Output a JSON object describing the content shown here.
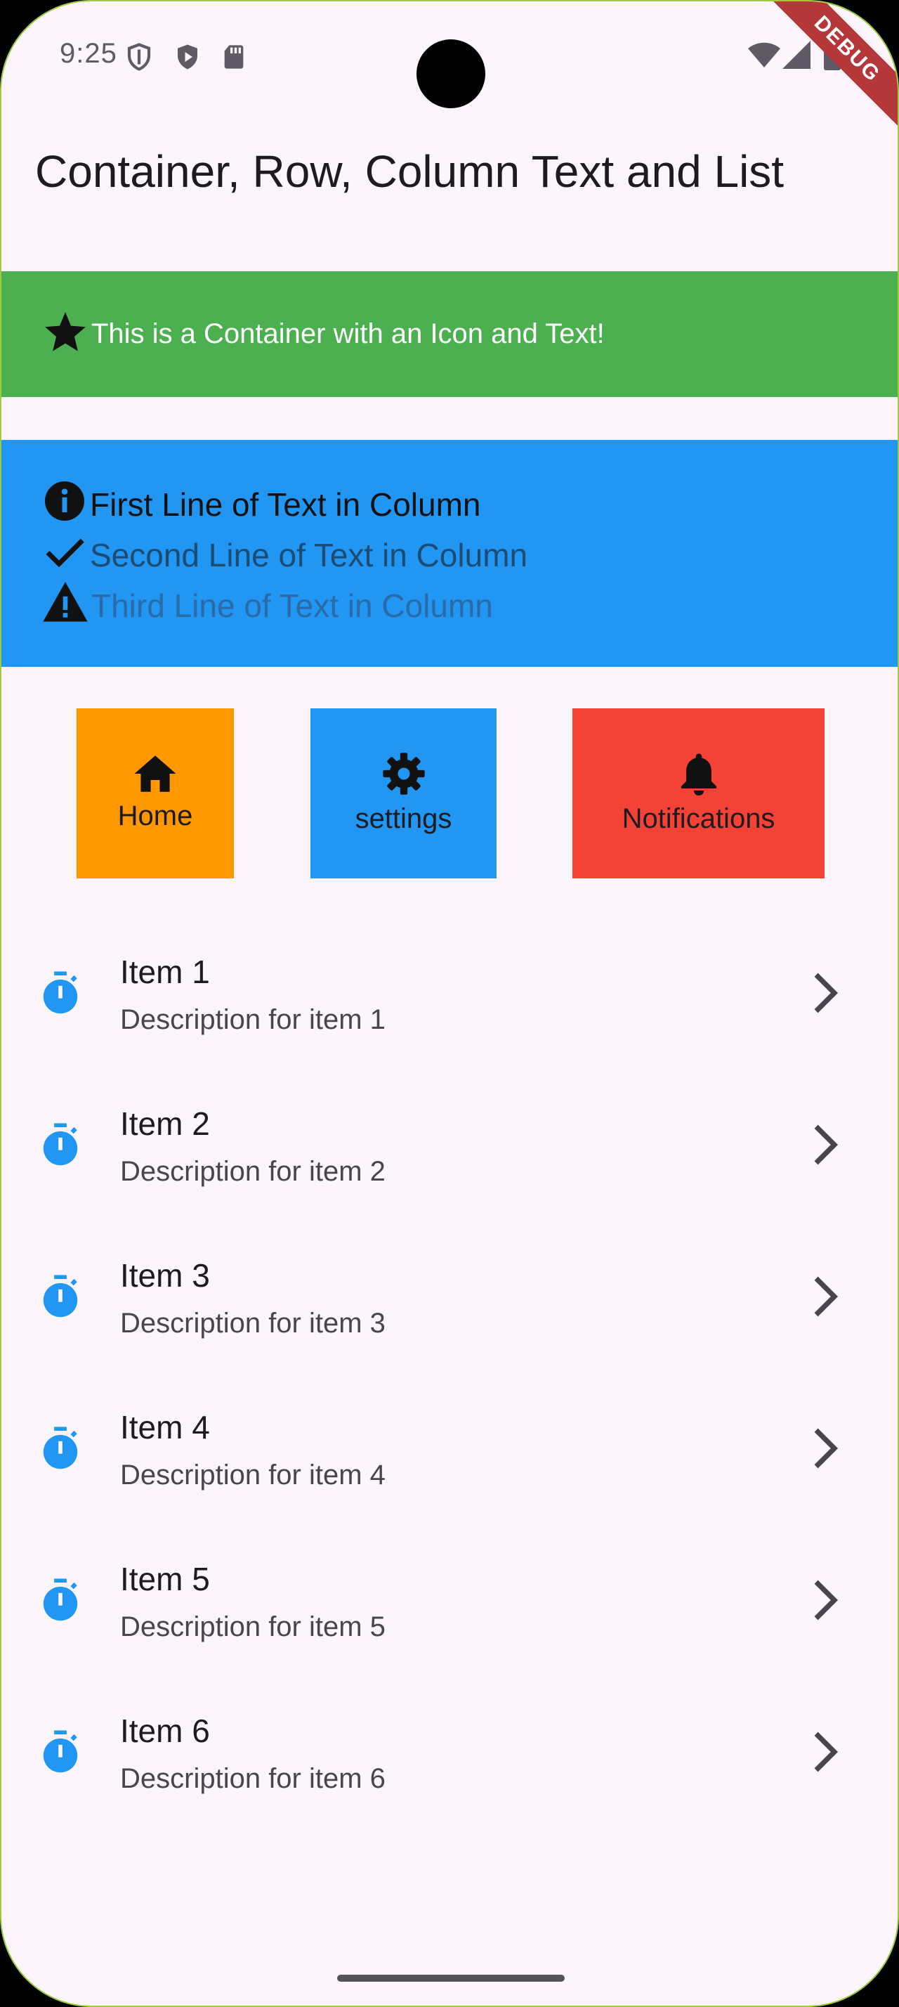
{
  "status_bar": {
    "time": "9:25",
    "left_icons": [
      "shield-outline-icon",
      "shield-play-icon",
      "sd-card-icon"
    ],
    "right_icons": [
      "wifi-icon",
      "signal-icon",
      "battery-icon"
    ],
    "debug_banner": "DEBUG"
  },
  "app_bar": {
    "title": "Container, Row, Column Text and List"
  },
  "green_container": {
    "icon": "star-icon",
    "text": "This is a Container with an Icon and Text!",
    "background": "#4caf50"
  },
  "blue_column": {
    "background": "#2196f3",
    "lines": [
      {
        "icon": "info-icon",
        "text": "First Line of Text in Column",
        "color": "#111111"
      },
      {
        "icon": "check-icon",
        "text": "Second Line of Text in Column",
        "color": "#1c4b73"
      },
      {
        "icon": "warning-icon",
        "text": "Third Line of Text in Column",
        "color": "#2a6aa6"
      }
    ]
  },
  "row_tiles": [
    {
      "icon": "home-icon",
      "label": "Home",
      "background": "#ff9800"
    },
    {
      "icon": "gear-icon",
      "label": "settings",
      "background": "#2196f3"
    },
    {
      "icon": "bell-icon",
      "label": "Notifications",
      "background": "#f44336"
    }
  ],
  "list": {
    "leading_icon": "timer-icon",
    "trailing_icon": "chevron-right-icon",
    "accent": "#2196f3",
    "items": [
      {
        "title": "Item 1",
        "subtitle": "Description for item 1"
      },
      {
        "title": "Item 2",
        "subtitle": "Description for item 2"
      },
      {
        "title": "Item 3",
        "subtitle": "Description for item 3"
      },
      {
        "title": "Item 4",
        "subtitle": "Description for item 4"
      },
      {
        "title": "Item 5",
        "subtitle": "Description for item 5"
      },
      {
        "title": "Item 6",
        "subtitle": "Description for item 6"
      }
    ]
  }
}
